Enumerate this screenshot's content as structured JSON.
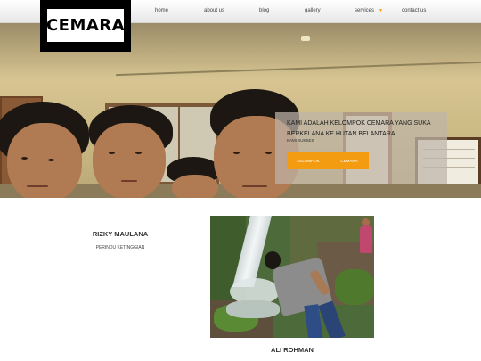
{
  "logo": {
    "text": "CEMARA"
  },
  "nav": {
    "items": [
      {
        "label": "home"
      },
      {
        "label": "about us"
      },
      {
        "label": "blog"
      },
      {
        "label": "gallery"
      },
      {
        "label": "services"
      },
      {
        "label": "contact us"
      }
    ],
    "caret_icon": "caret-down-icon"
  },
  "hero": {
    "title": "KAMI ADALAH KELOMPOK CEMARA YANG SUKA BERKELANA KE HUTAN BELANTARA",
    "subtitle": "KAMI SUKSES",
    "buttons": [
      {
        "label": "KELOMPOK"
      },
      {
        "label": "CEMARA"
      }
    ]
  },
  "profiles": [
    {
      "name": "RIZKY MAULANA",
      "role": "PERINDU KETINGGIAN"
    },
    {
      "name": "ALI ROHMAN"
    }
  ],
  "colors": {
    "accent": "#f39c12",
    "nav_text": "#444444",
    "heading_text": "#333333"
  }
}
